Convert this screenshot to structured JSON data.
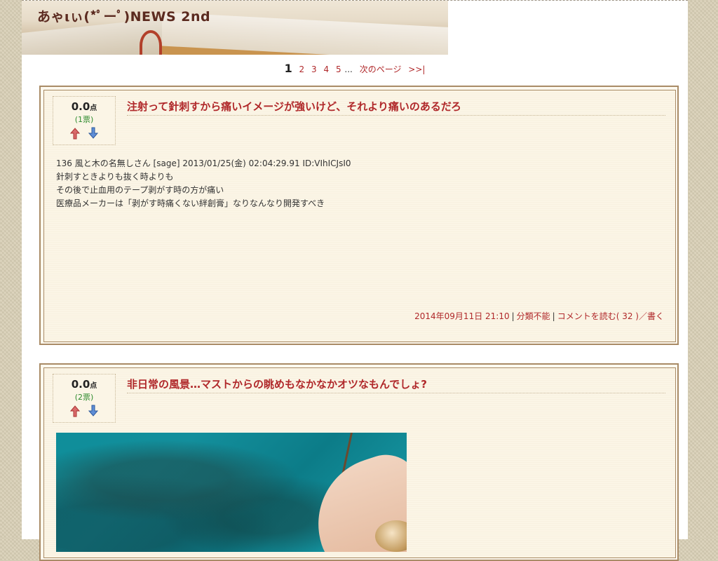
{
  "site": {
    "title": "あゃιぃ(*ﾟーﾟ)NEWS 2nd"
  },
  "pager": {
    "current": "1",
    "pages": [
      "2",
      "3",
      "4",
      "5"
    ],
    "ellipsis": "...",
    "next_label": "次のページ",
    "last_label": ">>|"
  },
  "articles": [
    {
      "score": "0.0",
      "score_unit": "点",
      "votes": "(1票)",
      "title": "注射って針刺すから痛いイメージが強いけど、それより痛いのあるだろ",
      "body": [
        "136 風と木の名無しさん [sage] 2013/01/25(金) 02:04:29.91 ID:VIhICJsI0",
        "針刺すときよりも抜く時よりも",
        "その後で止血用のテープ剥がす時の方が痛い",
        "医療品メーカーは「剥がす時痛くない絆創膏」なりなんなり開発すべき"
      ],
      "footer": {
        "datetime": "2014年09月11日 21:10",
        "category": "分類不能",
        "comments": "コメントを読む( 32 )",
        "write": "／書く"
      }
    },
    {
      "score": "0.0",
      "score_unit": "点",
      "votes": "(2票)",
      "title": "非日常の風景…マストからの眺めもなかなかオツなもんでしょ?"
    }
  ],
  "colors": {
    "accent": "#b0282a",
    "vote_green": "#2f8c2f",
    "frame": "#a98b66",
    "background": "#d9cfb6"
  }
}
